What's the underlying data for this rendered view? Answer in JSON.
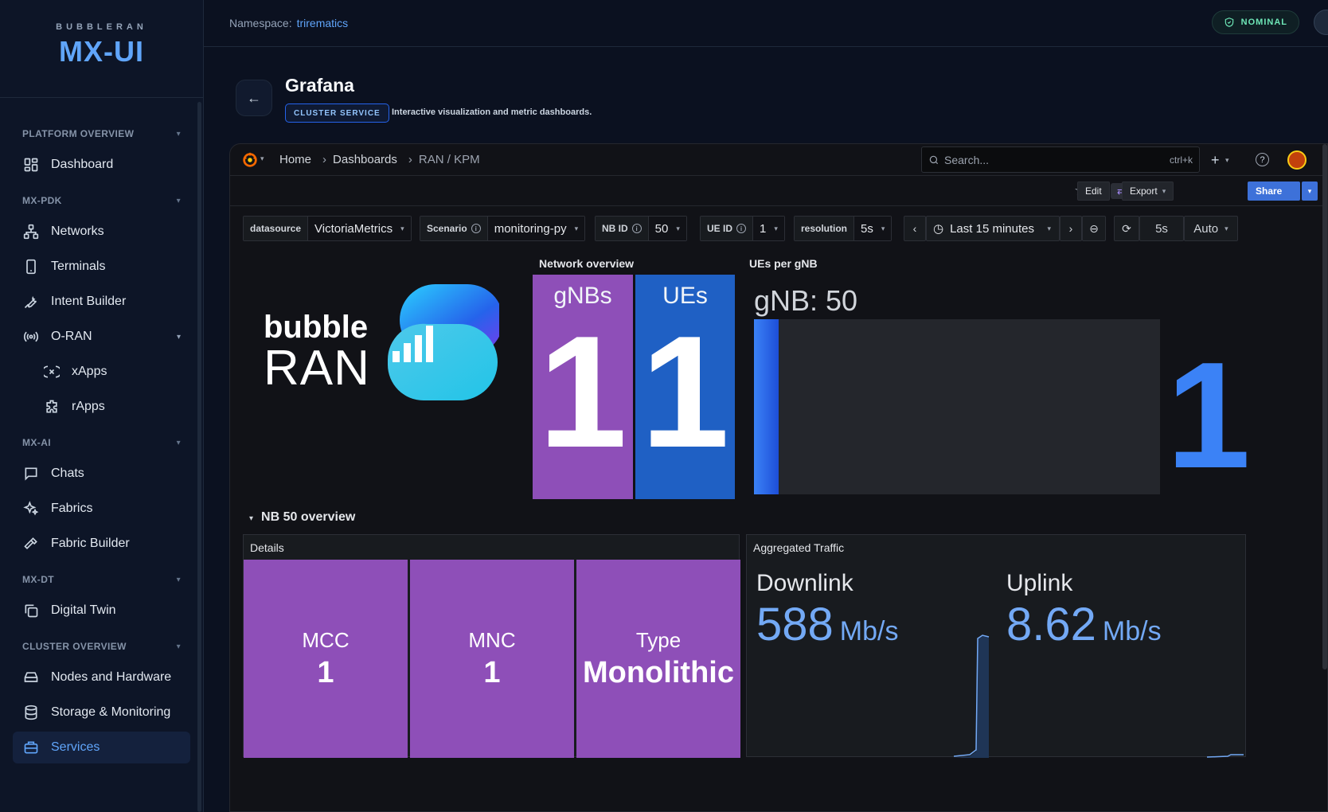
{
  "brand": {
    "sub": "BUBBLERAN",
    "main": "MX-UI"
  },
  "sidebar": {
    "sections": [
      {
        "title": "PLATFORM OVERVIEW",
        "items": [
          {
            "label": "Dashboard",
            "icon": "dashboard-icon"
          }
        ]
      },
      {
        "title": "MX-PDK",
        "items": [
          {
            "label": "Networks",
            "icon": "network-icon"
          },
          {
            "label": "Terminals",
            "icon": "phone-icon"
          },
          {
            "label": "Intent Builder",
            "icon": "wrench-icon"
          },
          {
            "label": "O-RAN",
            "icon": "antenna-icon"
          },
          {
            "label": "xApps",
            "icon": "xapp-icon"
          },
          {
            "label": "rApps",
            "icon": "puzzle-icon"
          }
        ]
      },
      {
        "title": "MX-AI",
        "items": [
          {
            "label": "Chats",
            "icon": "chat-icon"
          },
          {
            "label": "Fabrics",
            "icon": "sparkles-icon"
          },
          {
            "label": "Fabric Builder",
            "icon": "hammer-icon"
          }
        ]
      },
      {
        "title": "MX-DT",
        "items": [
          {
            "label": "Digital Twin",
            "icon": "copy-icon"
          }
        ]
      },
      {
        "title": "CLUSTER OVERVIEW",
        "items": [
          {
            "label": "Nodes and Hardware",
            "icon": "server-icon"
          },
          {
            "label": "Storage & Monitoring",
            "icon": "database-icon"
          },
          {
            "label": "Services",
            "icon": "services-icon"
          }
        ]
      }
    ]
  },
  "topbar": {
    "namespace_label": "Namespace:",
    "namespace_value": "trirematics",
    "status": "NOMINAL"
  },
  "page": {
    "title": "Grafana",
    "badge": "CLUSTER SERVICE",
    "description": "Interactive visualization and metric dashboards."
  },
  "grafana": {
    "breadcrumbs": [
      "Home",
      "Dashboards",
      "RAN / KPM"
    ],
    "search_placeholder": "Search...",
    "search_shortcut": "ctrl+k",
    "toolbar": {
      "edit": "Edit",
      "export": "Export",
      "share": "Share"
    },
    "variables": {
      "datasource": {
        "label": "datasource",
        "value": "VictoriaMetrics"
      },
      "scenario": {
        "label": "Scenario",
        "value": "monitoring-py"
      },
      "nb_id": {
        "label": "NB ID",
        "value": "50"
      },
      "ue_id": {
        "label": "UE ID",
        "value": "1"
      },
      "resolution": {
        "label": "resolution",
        "value": "5s"
      }
    },
    "time_range": "Last 15 minutes",
    "refresh_interval": "5s",
    "refresh_mode": "Auto",
    "logo": {
      "line1": "bubble",
      "line2": "RAN"
    },
    "network_overview": {
      "title": "Network overview",
      "gnbs_label": "gNBs",
      "gnbs_value": "1",
      "ues_label": "UEs",
      "ues_value": "1"
    },
    "ues_per_gnb": {
      "title": "UEs per gNB",
      "gauge_label": "gNB: 50",
      "value": "1",
      "fill_fraction": 0.06
    },
    "row_title": "NB 50 overview",
    "details": {
      "title": "Details",
      "tiles": [
        {
          "label": "MCC",
          "value": "1"
        },
        {
          "label": "MNC",
          "value": "1"
        },
        {
          "label": "Type",
          "value": "Monolithic"
        }
      ]
    },
    "traffic": {
      "title": "Aggregated Traffic",
      "downlink": {
        "label": "Downlink",
        "value": "588",
        "unit": "Mb/s"
      },
      "uplink": {
        "label": "Uplink",
        "value": "8.62",
        "unit": "Mb/s"
      }
    },
    "colors": {
      "stat_purple": "#8e4fb8",
      "stat_blue": "#1f60c4",
      "accent": "#3b82f6"
    }
  }
}
